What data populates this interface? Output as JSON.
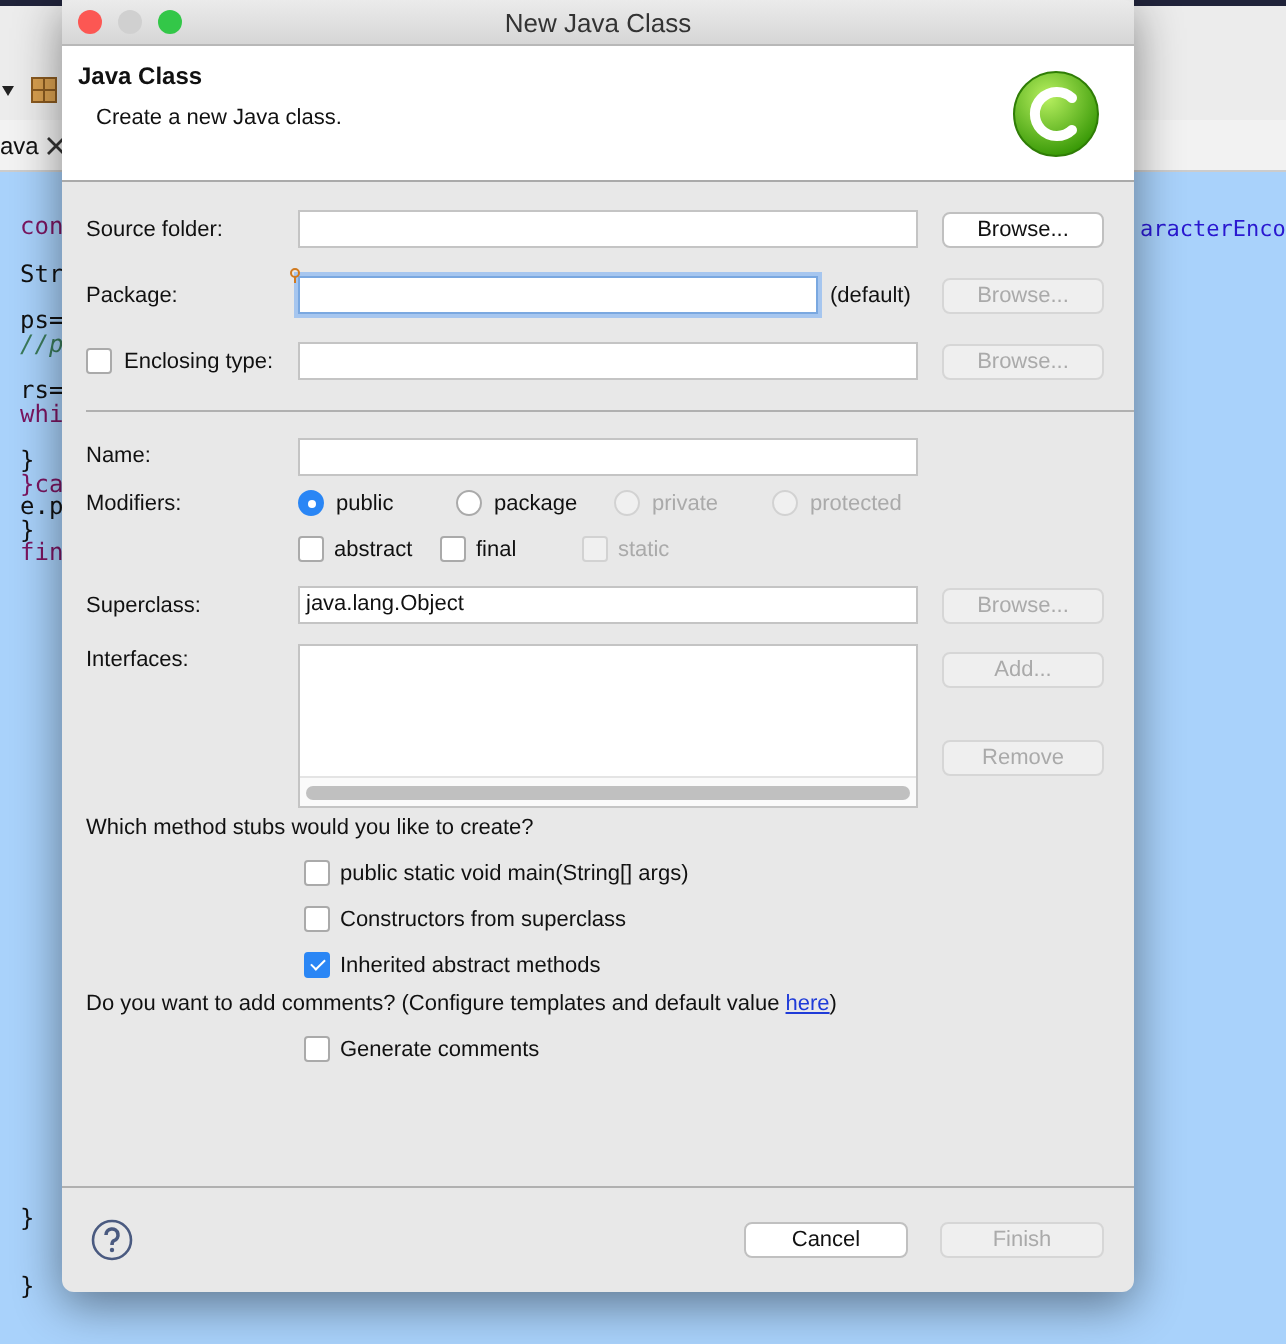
{
  "editor": {
    "tab_label": "ava",
    "lines": [
      {
        "text": "con",
        "kind": "keyword"
      },
      {
        "text": "Str",
        "kind": "plain"
      },
      {
        "text": "ps=",
        "kind": "plain"
      },
      {
        "text": "//p",
        "kind": "comment"
      },
      {
        "text": "rs=",
        "kind": "plain"
      },
      {
        "text": "whi",
        "kind": "keyword"
      },
      {
        "text": "}",
        "kind": "plain"
      },
      {
        "text": "}ca",
        "kind": "keyword"
      },
      {
        "text": "e.p",
        "kind": "plain"
      },
      {
        "text": "}",
        "kind": "plain"
      },
      {
        "text": "fin",
        "kind": "keyword"
      }
    ],
    "bottom_lines": [
      {
        "text": "}"
      },
      {
        "text": "}"
      }
    ],
    "right_text": "aracterEnco"
  },
  "window": {
    "title": "New Java Class"
  },
  "header": {
    "title": "Java Class",
    "description": "Create a new Java class."
  },
  "form": {
    "source_folder": {
      "label": "Source folder:",
      "button": {
        "label": "Browse...",
        "disabled": false
      }
    },
    "package": {
      "label": "Package:",
      "focused": true,
      "hint": "(default)",
      "button": {
        "label": "Browse...",
        "disabled": true
      }
    },
    "enclosing_type": {
      "label": "Enclosing type:",
      "checked": false,
      "button": {
        "label": "Browse...",
        "disabled": true
      }
    },
    "name": {
      "label": "Name:"
    },
    "modifiers": {
      "label": "Modifiers:",
      "access": [
        {
          "label": "public",
          "selected": true,
          "disabled": false
        },
        {
          "label": "package",
          "selected": false,
          "disabled": false
        },
        {
          "label": "private",
          "selected": false,
          "disabled": true
        },
        {
          "label": "protected",
          "selected": false,
          "disabled": true
        }
      ],
      "flags": [
        {
          "label": "abstract",
          "checked": false,
          "disabled": false
        },
        {
          "label": "final",
          "checked": false,
          "disabled": false
        },
        {
          "label": "static",
          "checked": false,
          "disabled": true
        }
      ]
    },
    "superclass": {
      "label": "Superclass:",
      "value": "java.lang.Object",
      "button": {
        "label": "Browse...",
        "disabled": true
      }
    },
    "interfaces": {
      "label": "Interfaces:",
      "buttons": [
        {
          "label": "Add...",
          "disabled": true
        },
        {
          "label": "Remove",
          "disabled": true
        }
      ]
    },
    "stubs": {
      "question": "Which method stubs would you like to create?",
      "options": [
        {
          "label": "public static void main(String[] args)",
          "checked": false
        },
        {
          "label": "Constructors from superclass",
          "checked": false
        },
        {
          "label": "Inherited abstract methods",
          "checked": true
        }
      ]
    },
    "comments": {
      "question_before": "Do you want to add comments? (Configure templates and default value ",
      "link": "here",
      "question_after": ")",
      "options": [
        {
          "label": "Generate comments",
          "checked": false
        }
      ]
    }
  },
  "footer": {
    "buttons": [
      {
        "label": "Cancel",
        "disabled": false
      },
      {
        "label": "Finish",
        "disabled": true
      }
    ]
  }
}
